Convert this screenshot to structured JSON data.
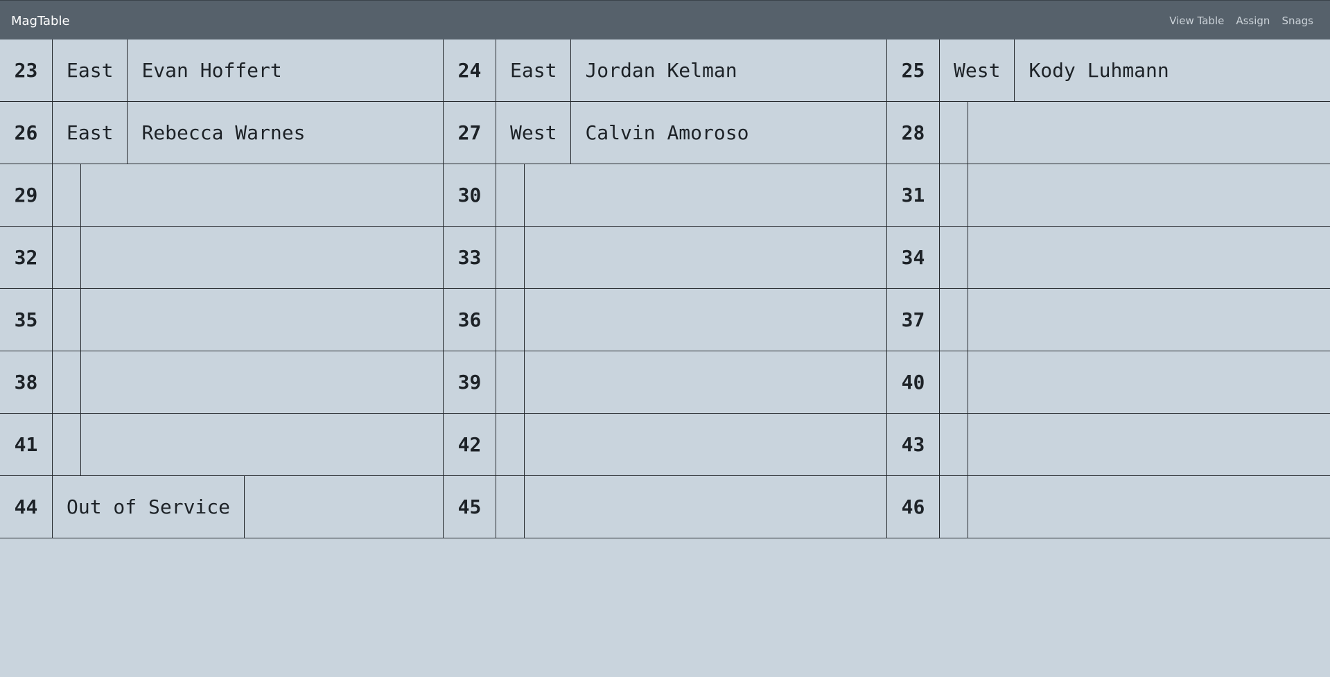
{
  "app": {
    "title": "MagTable"
  },
  "nav": {
    "links": [
      "View Table",
      "Assign",
      "Snags"
    ]
  },
  "rows": [
    [
      {
        "num": "23",
        "region": "East",
        "name": "Evan Hoffert"
      },
      {
        "num": "24",
        "region": "East",
        "name": "Jordan Kelman"
      },
      {
        "num": "25",
        "region": "West",
        "name": "Kody Luhmann"
      }
    ],
    [
      {
        "num": "26",
        "region": "East",
        "name": "Rebecca Warnes"
      },
      {
        "num": "27",
        "region": "West",
        "name": "Calvin Amoroso"
      },
      {
        "num": "28",
        "region": "",
        "name": ""
      }
    ],
    [
      {
        "num": "29",
        "region": "",
        "name": ""
      },
      {
        "num": "30",
        "region": "",
        "name": ""
      },
      {
        "num": "31",
        "region": "",
        "name": ""
      }
    ],
    [
      {
        "num": "32",
        "region": "",
        "name": ""
      },
      {
        "num": "33",
        "region": "",
        "name": ""
      },
      {
        "num": "34",
        "region": "",
        "name": ""
      }
    ],
    [
      {
        "num": "35",
        "region": "",
        "name": ""
      },
      {
        "num": "36",
        "region": "",
        "name": ""
      },
      {
        "num": "37",
        "region": "",
        "name": ""
      }
    ],
    [
      {
        "num": "38",
        "region": "",
        "name": ""
      },
      {
        "num": "39",
        "region": "",
        "name": ""
      },
      {
        "num": "40",
        "region": "",
        "name": ""
      }
    ],
    [
      {
        "num": "41",
        "region": "",
        "name": ""
      },
      {
        "num": "42",
        "region": "",
        "name": ""
      },
      {
        "num": "43",
        "region": "",
        "name": ""
      }
    ],
    [
      {
        "num": "44",
        "region": "Out of Service",
        "name": ""
      },
      {
        "num": "45",
        "region": "",
        "name": ""
      },
      {
        "num": "46",
        "region": "",
        "name": ""
      }
    ]
  ],
  "colors": {
    "navbar": "#56616b",
    "background": "#c9d4dd",
    "grid_line": "#25292d",
    "text": "#1d2227",
    "nav_link": "#cbd2d8"
  }
}
